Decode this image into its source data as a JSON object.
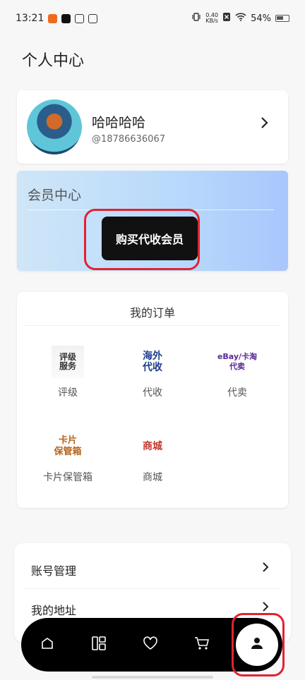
{
  "status_bar": {
    "time": "13:21",
    "net_speed_value": "0.40",
    "net_speed_unit": "KB/s",
    "battery": "54%"
  },
  "header": {
    "title": "个人中心"
  },
  "profile": {
    "name": "哈哈哈哈",
    "phone": "@18786636067"
  },
  "membership": {
    "title": "会员中心",
    "button_label": "购买代收会员"
  },
  "orders": {
    "title": "我的订单",
    "items": [
      {
        "icon_text": "评级\n服务",
        "icon_name": "grading-icon",
        "label": "评级"
      },
      {
        "icon_text": "海外\n代收",
        "icon_name": "overseas-collect-icon",
        "label": "代收"
      },
      {
        "icon_text": "eBay/卡淘\n代卖",
        "icon_name": "consign-sell-icon",
        "label": "代卖"
      },
      {
        "icon_text": "卡片\n保管箱",
        "icon_name": "card-vault-icon",
        "label": "卡片保管箱"
      },
      {
        "icon_text": "商城",
        "icon_name": "mall-icon",
        "label": "商城"
      }
    ]
  },
  "settings_list": {
    "items": [
      {
        "label": "账号管理"
      },
      {
        "label": "我的地址"
      }
    ]
  },
  "bottom_nav": {
    "items": [
      "home-icon",
      "dashboard-icon",
      "favorites-icon",
      "cart-icon",
      "profile-icon"
    ],
    "active": "profile-icon"
  },
  "colors": {
    "accent": "#111111",
    "highlight": "#e0242f",
    "member_gradient_start": "#cfe6f8",
    "member_gradient_end": "#a9c6fc"
  }
}
